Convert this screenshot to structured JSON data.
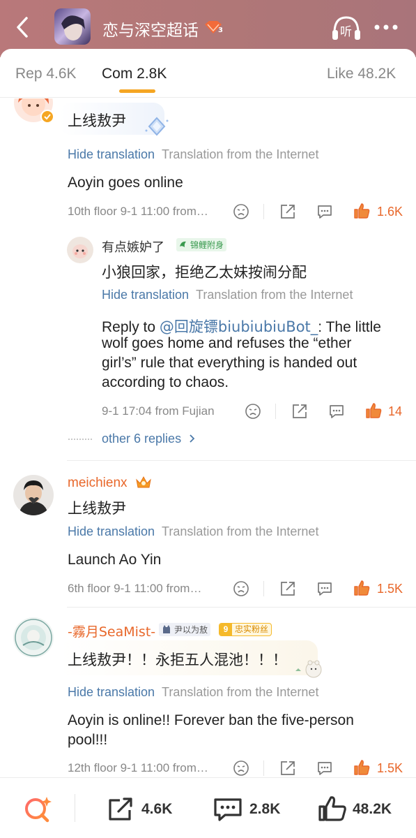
{
  "header": {
    "title": "恋与深空超话",
    "level_badge": "3",
    "listen_label": "听",
    "colors": {
      "bg": "#b07777",
      "accent": "#f5a623",
      "like": "#e8672a",
      "link": "#4a78a8"
    }
  },
  "tabs": [
    {
      "label": "Rep 4.6K"
    },
    {
      "label": "Com 2.8K"
    },
    {
      "label": "Like 48.2K"
    }
  ],
  "comments": [
    {
      "original": "上线敖尹",
      "hide_label": "Hide translation",
      "translation_note": "Translation from the Internet",
      "translation": "Aoyin goes online",
      "meta": "10th floor  9-1 11:00  from…",
      "likes": "1.6K",
      "reply": {
        "username": "有点嫉妒了",
        "badge": "锦鲤附身",
        "original": "小狼回家，拒绝乙太妹按闹分配",
        "hide_label": "Hide translation",
        "translation_note": "Translation from the Internet",
        "reply_prefix": "Reply to ",
        "mention": "@回旋镖biubiubiuBot_",
        "line1_rest": ": The little",
        "line2": "wolf goes home and refuses the “ether",
        "line3": "girl’s” rule that everything is handed out",
        "line4": "according to chaos.",
        "meta": "9-1 17:04  from Fujian",
        "likes": "14"
      },
      "more_replies": "other 6 replies"
    },
    {
      "username": "meichienx",
      "original": "上线敖尹",
      "hide_label": "Hide translation",
      "translation_note": "Translation from the Internet",
      "translation": "Launch Ao Yin",
      "meta": "6th floor  9-1 11:00  from…",
      "likes": "1.5K"
    },
    {
      "username": "-霧月SeaMist-",
      "badge1": "尹以为敖",
      "badge2_level": "9",
      "badge2": "忠实粉丝",
      "original": "上线敖尹！！永拒五人混池！！！",
      "hide_label": "Hide translation",
      "translation_note": "Translation from the Internet",
      "translation_line1": "Aoyin is online!! Forever ban the five-person",
      "translation_line2": "pool!!!",
      "meta": "12th floor  9-1 11:00  from…",
      "likes": "1.5K"
    }
  ],
  "bottom_bar": {
    "repost_count": "4.6K",
    "comment_count": "2.8K",
    "like_count": "48.2K"
  }
}
